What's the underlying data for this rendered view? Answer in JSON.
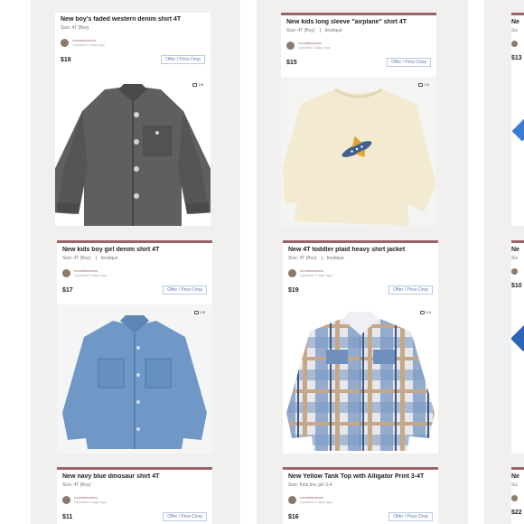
{
  "listings": [
    {
      "title": "New boy's faded western denim shirt 4T",
      "size": "Size: 4T (Boy)",
      "brand": "",
      "seller": "ronniebluewho",
      "updated": "Updated 5 days ago",
      "price": "$18",
      "offer_label": "Offer / Price Drop",
      "photo_count": "1/6",
      "photo_icon": "gray-denim-shirt-photo"
    },
    {
      "title": "New kids long sleeve \"airplane\" shirt 4T",
      "size": "Size: 4T (Boy)",
      "brand": "boutique",
      "seller": "ronniebluewho",
      "updated": "Updated 5 days ago",
      "price": "$15",
      "offer_label": "Offer / Price Drop",
      "photo_count": "1/4",
      "photo_icon": "cream-airplane-shirt-photo"
    },
    {
      "title": "New kids boy girl denim shirt 4T",
      "size": "Size: 4T (Boy)",
      "brand": "boutique",
      "seller": "ronniebluewho",
      "updated": "Updated 5 days ago",
      "price": "$17",
      "offer_label": "Offer / Price Drop",
      "photo_count": "1/5",
      "photo_icon": "blue-denim-shirt-photo"
    },
    {
      "title": "New 4T toddler plaid heavy shirt jacket",
      "size": "Size: 4T (Boy)",
      "brand": "boutique",
      "seller": "ronniebluewho",
      "updated": "Updated 5 days ago",
      "price": "$19",
      "offer_label": "Offer / Price Drop",
      "photo_count": "1/4",
      "photo_icon": "plaid-shirt-jacket-photo"
    },
    {
      "title": "New navy blue dinosaur shirt 4T",
      "size": "Size: 4T (Boy)",
      "brand": "",
      "seller": "ronniebluewho",
      "updated": "Updated 5 days ago",
      "price": "$11",
      "offer_label": "Offer / Price Drop"
    },
    {
      "title": "New Yellow Tank Top with Alligator Print 3-4T",
      "size": "Size: Kids boy girl 3-4",
      "brand": "",
      "seller": "ronniebluewho",
      "updated": "Updated 5 days ago",
      "price": "$16",
      "offer_label": "Offer / Price Drop"
    }
  ],
  "partial_listings": [
    {
      "title_fragment": "Ne",
      "size_fragment": "Siz",
      "price_fragment": "$13"
    },
    {
      "title_fragment": "Ne",
      "size_fragment": "Siz",
      "price_fragment": "$10"
    },
    {
      "title_fragment": "Ne",
      "size_fragment": "Siz",
      "price_fragment": "$22"
    }
  ]
}
